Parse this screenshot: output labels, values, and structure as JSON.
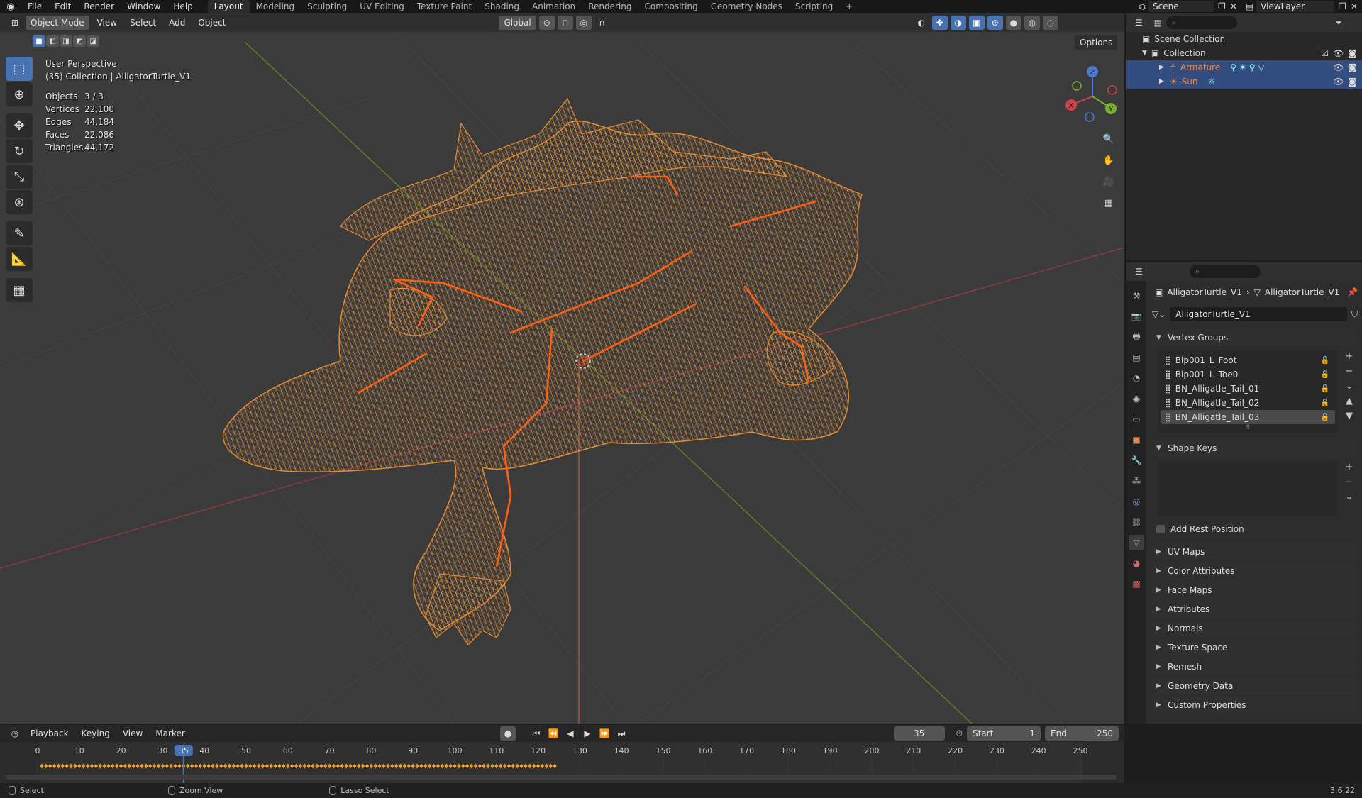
{
  "topbar": {
    "menu": [
      "File",
      "Edit",
      "Render",
      "Window",
      "Help"
    ],
    "workspaces": [
      "Layout",
      "Modeling",
      "Sculpting",
      "UV Editing",
      "Texture Paint",
      "Shading",
      "Animation",
      "Rendering",
      "Compositing",
      "Geometry Nodes",
      "Scripting"
    ],
    "active_workspace": "Layout",
    "add_tab": "+",
    "scene": "Scene",
    "view_layer": "ViewLayer"
  },
  "viewport": {
    "mode": "Object Mode",
    "menu": [
      "View",
      "Select",
      "Add",
      "Object"
    ],
    "transform_orientation": "Global",
    "options": "Options",
    "info": {
      "view_name": "User Perspective",
      "collection_line": "(35) Collection | AlligatorTurtle_V1",
      "stats": [
        {
          "label": "Objects",
          "value": "3 / 3"
        },
        {
          "label": "Vertices",
          "value": "22,100"
        },
        {
          "label": "Edges",
          "value": "44,184"
        },
        {
          "label": "Faces",
          "value": "22,086"
        },
        {
          "label": "Triangles",
          "value": "44,172"
        }
      ]
    },
    "gizmo": {
      "x": "X",
      "y": "Y",
      "z": "Z"
    },
    "tools": [
      "select-box-icon",
      "cursor-icon",
      "move-icon",
      "rotate-icon",
      "scale-icon",
      "transform-icon",
      "annotate-icon",
      "measure-icon",
      "add-cube-icon"
    ],
    "colors": {
      "wire": "#d98a3a",
      "bone": "#ff6a1f",
      "x_axis": "#b53a44",
      "y_axis": "#6e9a2c",
      "active_blue": "#4772b3"
    }
  },
  "outliner": {
    "rows": [
      {
        "label": "Scene Collection",
        "indent": 0
      },
      {
        "label": "Collection",
        "indent": 1
      },
      {
        "label": "Armature",
        "indent": 2,
        "selected": true
      },
      {
        "label": "Sun",
        "indent": 2,
        "selected": true
      }
    ]
  },
  "properties": {
    "breadcrumb": [
      "AlligatorTurtle_V1",
      "AlligatorTurtle_V1"
    ],
    "mesh_name": "AlligatorTurtle_V1",
    "vertex_groups": {
      "title": "Vertex Groups",
      "items": [
        "Bip001_L_Foot",
        "Bip001_L_Toe0",
        "BN_Alligatle_Tail_01",
        "BN_Alligatle_Tail_02",
        "BN_Alligatle_Tail_03"
      ],
      "selected": "BN_Alligatle_Tail_03"
    },
    "shape_keys": {
      "title": "Shape Keys",
      "add_rest": "Add Rest Position"
    },
    "collapsed_panels": [
      "UV Maps",
      "Color Attributes",
      "Face Maps",
      "Attributes",
      "Normals",
      "Texture Space",
      "Remesh",
      "Geometry Data",
      "Custom Properties"
    ]
  },
  "timeline": {
    "menu": [
      "Playback",
      "Keying",
      "View",
      "Marker"
    ],
    "current_frame": "35",
    "start_label": "Start",
    "start": "1",
    "end_label": "End",
    "end": "250",
    "ticks": [
      "0",
      "10",
      "20",
      "30",
      "40",
      "50",
      "60",
      "70",
      "80",
      "90",
      "100",
      "110",
      "120",
      "130",
      "140",
      "150",
      "160",
      "170",
      "180",
      "190",
      "200",
      "210",
      "220",
      "230",
      "240",
      "250"
    ]
  },
  "statusbar": {
    "items": [
      "Select",
      "Zoom View",
      "Lasso Select"
    ],
    "version": "3.6.22"
  }
}
